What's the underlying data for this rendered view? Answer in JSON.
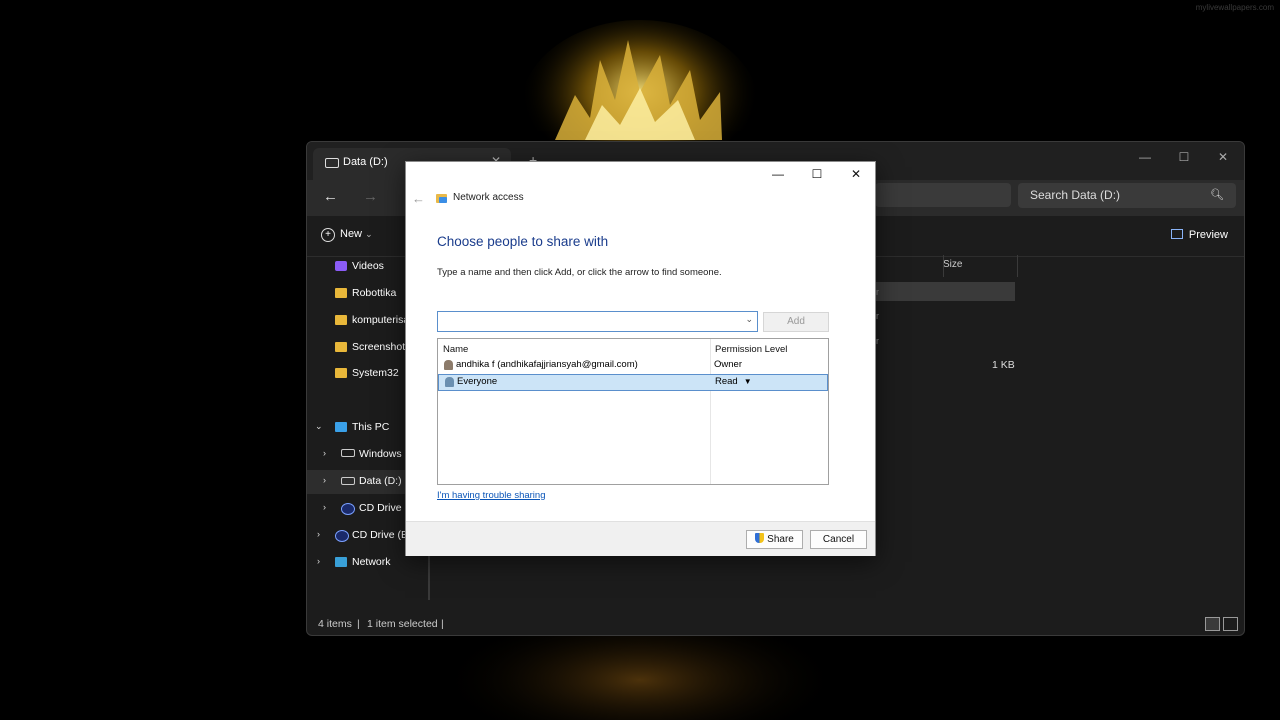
{
  "watermark": "mylivewallpapers.com",
  "explorer": {
    "tab_label": "Data (D:)",
    "tab_close": "✕",
    "new_tab": "+",
    "window_controls": {
      "minimize": "—",
      "maximize": "☐",
      "close": "✕"
    },
    "nav": {
      "back": "←",
      "forward": "→"
    },
    "search_placeholder": "Search Data (D:)",
    "command_bar": {
      "new_label": "New",
      "new_chevron": "⌄",
      "preview_label": "Preview"
    },
    "sidebar": {
      "items": [
        {
          "label": "Videos",
          "icon": "videos-folder-icon"
        },
        {
          "label": "Robottika",
          "icon": "folder-icon"
        },
        {
          "label": "komputerisa",
          "icon": "folder-icon"
        },
        {
          "label": "Screenshots",
          "icon": "folder-icon"
        },
        {
          "label": "System32",
          "icon": "folder-icon"
        },
        {
          "label": "This PC",
          "icon": "pc-icon",
          "caret": "⌄"
        },
        {
          "label": "Windows (",
          "icon": "drive-icon",
          "caret": "›"
        },
        {
          "label": "Data (D:)",
          "icon": "drive-icon",
          "caret": "›"
        },
        {
          "label": "CD Drive (",
          "icon": "cd-icon",
          "caret": "›"
        },
        {
          "label": "CD Drive (E:",
          "icon": "cd-icon",
          "caret": "›"
        },
        {
          "label": "Network",
          "icon": "network-icon",
          "caret": "›"
        }
      ]
    },
    "content": {
      "size_header": "Size",
      "row_fragments": [
        "r",
        "r",
        "r"
      ],
      "size_value": "1 KB"
    },
    "status": {
      "items_count": "4 items",
      "separator": "|",
      "selected": "1 item selected",
      "separator2": "|"
    }
  },
  "dialog": {
    "controls": {
      "minimize": "—",
      "maximize": "☐",
      "close": "✕"
    },
    "back": "←",
    "title": "Network access",
    "heading": "Choose people to share with",
    "instructions": "Type a name and then click Add, or click the arrow to find someone.",
    "input_value": "",
    "dropdown_arrow": "⌄",
    "add_label": "Add",
    "columns": {
      "name": "Name",
      "permission": "Permission Level"
    },
    "rows": [
      {
        "name": "andhika f (andhikafajjriansyah@gmail.com)",
        "permission": "Owner",
        "selected": false
      },
      {
        "name": "Everyone",
        "permission": "Read",
        "selected": true
      }
    ],
    "permission_arrow": "▼",
    "trouble_link": "I'm having trouble sharing",
    "share_label": "Share",
    "cancel_label": "Cancel"
  }
}
